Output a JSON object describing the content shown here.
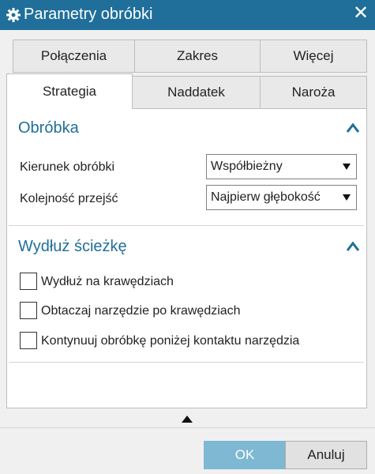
{
  "window": {
    "title": "Parametry obróbki",
    "close_label": "✕",
    "accent_color": "#1f6f9a"
  },
  "tabs": {
    "row1": [
      {
        "label": "Połączenia"
      },
      {
        "label": "Zakres"
      },
      {
        "label": "Więcej"
      }
    ],
    "row2": [
      {
        "label": "Strategia",
        "active": true
      },
      {
        "label": "Naddatek"
      },
      {
        "label": "Naroża"
      }
    ]
  },
  "sections": {
    "machining": {
      "title": "Obróbka",
      "direction_label": "Kierunek obróbki",
      "direction_value": "Współbieżny",
      "order_label": "Kolejność przejść",
      "order_value": "Najpierw głębokość"
    },
    "extend_path": {
      "title": "Wydłuż ścieżkę",
      "options": [
        {
          "label": "Wydłuż na krawędziach",
          "checked": false
        },
        {
          "label": "Obtaczaj narzędzie po krawędziach",
          "checked": false
        },
        {
          "label": "Kontynuuj obróbkę poniżej kontaktu narzędzia",
          "checked": false
        }
      ]
    }
  },
  "buttons": {
    "ok_label": "OK",
    "cancel_label": "Anuluj"
  }
}
